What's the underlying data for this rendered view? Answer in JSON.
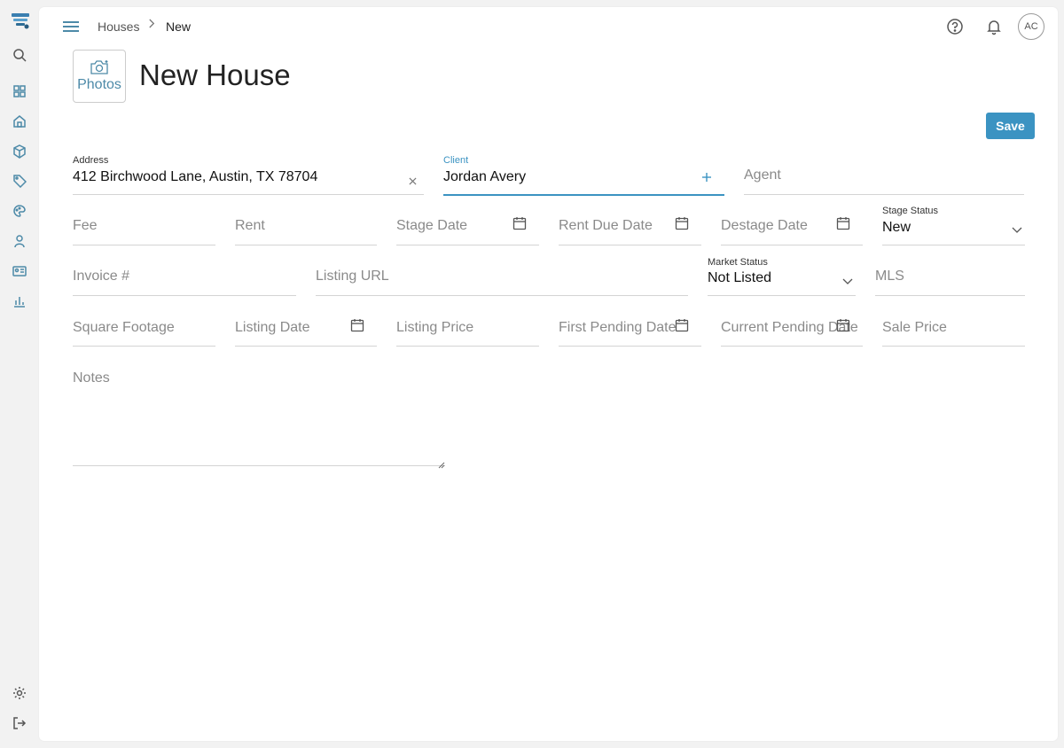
{
  "breadcrumb": {
    "parent": "Houses",
    "current": "New"
  },
  "header": {
    "avatar_initials": "AC"
  },
  "page": {
    "title": "New House",
    "photos_label": "Photos",
    "save_label": "Save"
  },
  "form": {
    "address": {
      "label": "Address",
      "value": "412 Birchwood Lane, Austin, TX 78704"
    },
    "client": {
      "label": "Client",
      "value": "Jordan Avery"
    },
    "agent": {
      "placeholder": "Agent"
    },
    "fee": {
      "placeholder": "Fee"
    },
    "rent": {
      "placeholder": "Rent"
    },
    "stage_date": {
      "placeholder": "Stage Date"
    },
    "rent_due_date": {
      "placeholder": "Rent Due Date"
    },
    "destage_date": {
      "placeholder": "Destage Date"
    },
    "stage_status": {
      "label": "Stage Status",
      "value": "New"
    },
    "invoice": {
      "placeholder": "Invoice #"
    },
    "listing_url": {
      "placeholder": "Listing URL"
    },
    "market_status": {
      "label": "Market Status",
      "value": "Not Listed"
    },
    "mls": {
      "placeholder": "MLS"
    },
    "square_footage": {
      "placeholder": "Square Footage"
    },
    "listing_date": {
      "placeholder": "Listing Date"
    },
    "listing_price": {
      "placeholder": "Listing Price"
    },
    "first_pending_date": {
      "placeholder": "First Pending Date"
    },
    "current_pending_date": {
      "placeholder": "Current Pending Date"
    },
    "sale_price": {
      "placeholder": "Sale Price"
    },
    "notes": {
      "placeholder": "Notes"
    }
  },
  "icons": {
    "rail": [
      "search-icon",
      "dashboard-icon",
      "home-icon",
      "box-icon",
      "tag-icon",
      "palette-icon",
      "user-icon",
      "id-card-icon",
      "bar-chart-icon",
      "settings-icon",
      "sign-out-icon"
    ],
    "top": [
      "help-icon",
      "bell-icon"
    ]
  },
  "colors": {
    "accent": "#3b93c2",
    "icon": "#4d8aa8"
  }
}
